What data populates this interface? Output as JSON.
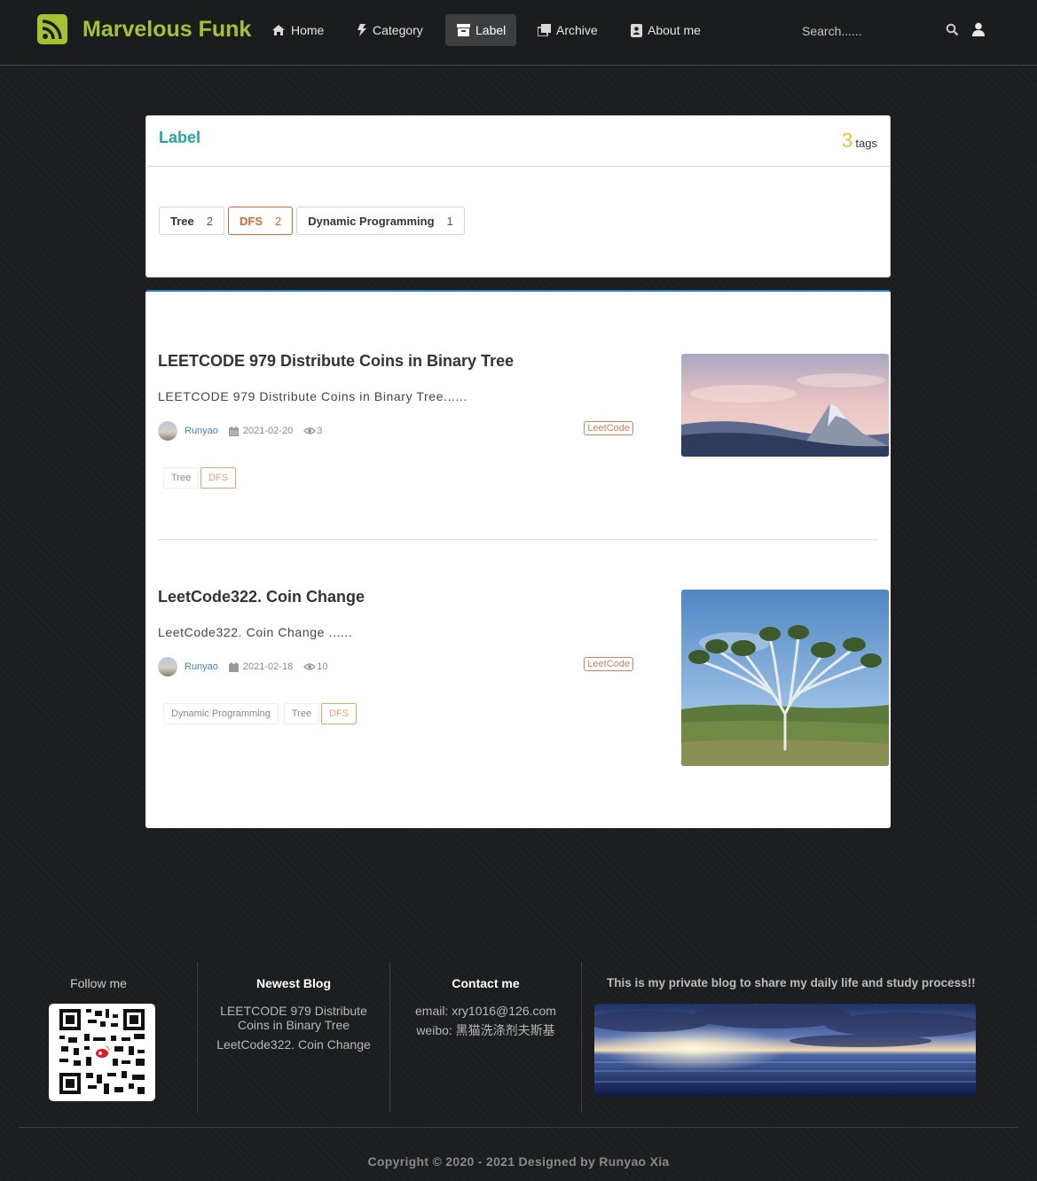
{
  "nav": {
    "brand": "Marvelous Funk",
    "items": [
      {
        "label": "Home",
        "icon": "home-icon"
      },
      {
        "label": "Category",
        "icon": "bolt-icon"
      },
      {
        "label": "Label",
        "icon": "archive-box-icon"
      },
      {
        "label": "Archive",
        "icon": "clone-icon"
      },
      {
        "label": "About me",
        "icon": "address-book-icon"
      }
    ],
    "active": "Label",
    "search_placeholder": "Search......"
  },
  "label_card": {
    "title": "Label",
    "tag_count": "3",
    "tag_count_unit": "tags",
    "tags": [
      {
        "name": "Tree",
        "count": "2",
        "active": false
      },
      {
        "name": "DFS",
        "count": "2",
        "active": true
      },
      {
        "name": "Dynamic Programming",
        "count": "1",
        "active": false
      }
    ]
  },
  "posts": [
    {
      "title": "LEETCODE 979 Distribute Coins in Binary Tree",
      "excerpt": "LEETCODE 979 Distribute Coins in Binary Tree......",
      "author": "Runyao",
      "date": "2021-02-20",
      "views": "3",
      "category": "LeetCode",
      "tags": [
        "Tree",
        "DFS"
      ],
      "active_tag": "DFS",
      "image": "snowy-mountain-peak-at-dusk"
    },
    {
      "title": "LeetCode322. Coin Change",
      "excerpt": "LeetCode322. Coin Change ......",
      "author": "Runyao",
      "date": "2021-02-18",
      "views": "10",
      "category": "LeetCode",
      "tags": [
        "Dynamic Programming",
        "Tree",
        "DFS"
      ],
      "active_tag": "DFS",
      "image": "branching-palm-tree-under-blue-sky"
    }
  ],
  "footer": {
    "follow_label": "Follow me",
    "newest_title": "Newest Blog",
    "newest_items": [
      "LEETCODE 979 Distribute Coins in Binary Tree",
      "LeetCode322. Coin Change"
    ],
    "contact_title": "Contact me",
    "email": "email: xry1016@126.com",
    "weibo": "weibo: 黑猫洗涤剂夫斯基",
    "tagline": "This is my private blog to share my daily life and study process!!",
    "copyright": "Copyright © 2020 - 2021 Designed by Runyao Xia"
  },
  "colors": {
    "brand": "#a5c330",
    "label_title": "#1ea89b",
    "tag_count": "#f2c037",
    "active_tag": "#e0662b",
    "author_link": "#4183c4",
    "card_top_border": "#2185d0"
  }
}
